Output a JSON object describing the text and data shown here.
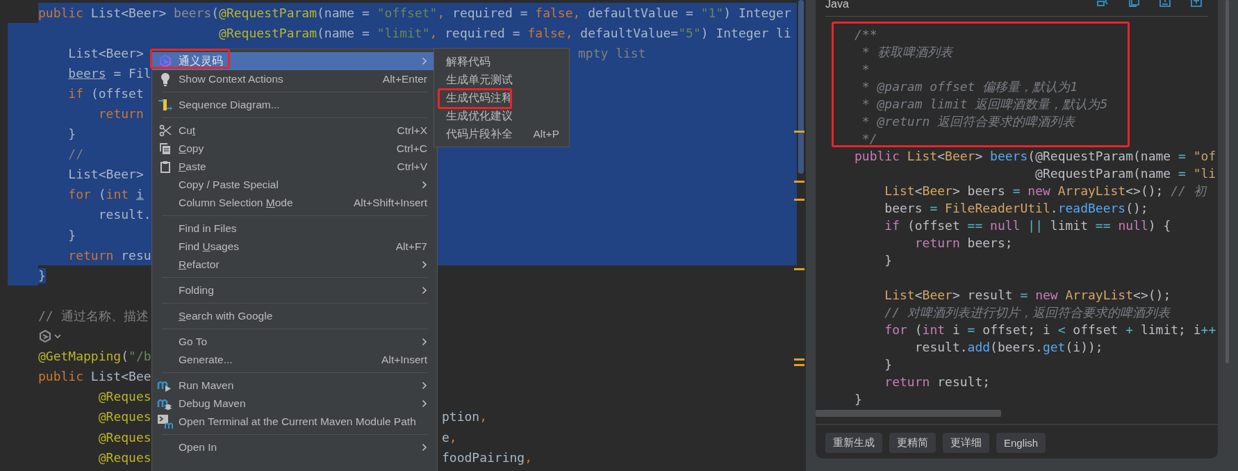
{
  "editor": {
    "lines": [
      {
        "kind": "code",
        "selected": true,
        "sel_start": true,
        "tokens": [
          {
            "text": "public ",
            "kind": "kw"
          },
          {
            "text": "List<Beer> ",
            "kind": "plain"
          },
          {
            "text": "beers",
            "kind": "muted"
          },
          {
            "text": "(",
            "kind": "plain"
          },
          {
            "text": "@RequestParam",
            "kind": "ann"
          },
          {
            "text": "(name = ",
            "kind": "plain"
          },
          {
            "text": "\"offset\"",
            "kind": "str"
          },
          {
            "text": ", ",
            "kind": "kw"
          },
          {
            "text": "required = ",
            "kind": "plain"
          },
          {
            "text": "false, ",
            "kind": "kw"
          },
          {
            "text": "defaultValue = ",
            "kind": "plain"
          },
          {
            "text": "\"1\"",
            "kind": "str"
          },
          {
            "text": ") Integer",
            "kind": "plain"
          }
        ]
      },
      {
        "kind": "code",
        "selected": true,
        "tokens": [
          {
            "text": "                        @RequestParam",
            "kind": "ann"
          },
          {
            "text": "(name = ",
            "kind": "plain"
          },
          {
            "text": "\"limit\"",
            "kind": "str"
          },
          {
            "text": ", ",
            "kind": "kw"
          },
          {
            "text": "required = ",
            "kind": "plain"
          },
          {
            "text": "false, ",
            "kind": "kw"
          },
          {
            "text": "defaultValue=",
            "kind": "plain"
          },
          {
            "text": "\"5\"",
            "kind": "str"
          },
          {
            "text": ") Integer li",
            "kind": "plain"
          }
        ]
      },
      {
        "kind": "code",
        "selected": true,
        "tokens": [
          {
            "text": "    List<Beer> ",
            "kind": "plain"
          }
        ],
        "tail": [
          {
            "text": "mpty list",
            "kind": "cmt"
          }
        ],
        "past_submenu": true
      },
      {
        "kind": "code",
        "selected": true,
        "tokens": [
          {
            "text": "    beers",
            "kind": "var"
          },
          {
            "text": " = Fil",
            "kind": "plain"
          }
        ]
      },
      {
        "kind": "code",
        "selected": true,
        "tokens": [
          {
            "text": "    if ",
            "kind": "kw"
          },
          {
            "text": "(offset ",
            "kind": "plain"
          }
        ]
      },
      {
        "kind": "code",
        "selected": true,
        "tokens": [
          {
            "text": "        return ",
            "kind": "kw"
          }
        ]
      },
      {
        "kind": "code",
        "selected": true,
        "tokens": [
          {
            "text": "    }",
            "kind": "plain"
          }
        ]
      },
      {
        "kind": "code",
        "selected": true,
        "tokens": [
          {
            "text": "    //",
            "kind": "cmt"
          }
        ]
      },
      {
        "kind": "code",
        "selected": true,
        "tokens": [
          {
            "text": "    List<Beer> ",
            "kind": "plain"
          }
        ]
      },
      {
        "kind": "code",
        "selected": true,
        "tokens": [
          {
            "text": "    for ",
            "kind": "kw"
          },
          {
            "text": "(",
            "kind": "plain"
          },
          {
            "text": "int ",
            "kind": "kw"
          },
          {
            "text": "i",
            "kind": "var"
          }
        ]
      },
      {
        "kind": "code",
        "selected": true,
        "tokens": [
          {
            "text": "        result.",
            "kind": "plain"
          }
        ]
      },
      {
        "kind": "code",
        "selected": true,
        "tokens": [
          {
            "text": "    }",
            "kind": "plain"
          }
        ]
      },
      {
        "kind": "code",
        "selected": true,
        "tokens": [
          {
            "text": "    return ",
            "kind": "kw"
          },
          {
            "text": "resu",
            "kind": "plain"
          }
        ]
      },
      {
        "kind": "code",
        "selected": true,
        "sel_end": true,
        "tokens": [
          {
            "text": "}",
            "kind": "plain"
          }
        ]
      },
      {
        "kind": "blank"
      },
      {
        "kind": "code",
        "tokens": [
          {
            "text": "// 通过名称、描述",
            "kind": "cmt"
          }
        ]
      },
      {
        "kind": "hint"
      },
      {
        "kind": "code",
        "tokens": [
          {
            "text": "@GetMapping",
            "kind": "ann"
          },
          {
            "text": "(",
            "kind": "plain"
          },
          {
            "text": "\"/b",
            "kind": "str"
          }
        ]
      },
      {
        "kind": "code",
        "tokens": [
          {
            "text": "public ",
            "kind": "kw"
          },
          {
            "text": "List<Bee",
            "kind": "plain"
          }
        ]
      },
      {
        "kind": "code",
        "tokens": [
          {
            "text": "        @Reques",
            "kind": "ann"
          }
        ]
      },
      {
        "kind": "code",
        "tokens": [
          {
            "text": "        @Reques",
            "kind": "ann"
          }
        ],
        "tail": [
          {
            "text": "ption",
            "kind": "plain"
          },
          {
            "text": ",",
            "kind": "kw"
          }
        ]
      },
      {
        "kind": "code",
        "tokens": [
          {
            "text": "        @Reques",
            "kind": "ann"
          }
        ],
        "tail": [
          {
            "text": "e",
            "kind": "plain"
          },
          {
            "text": ",",
            "kind": "kw"
          }
        ]
      },
      {
        "kind": "code",
        "tokens": [
          {
            "text": "        @Reques",
            "kind": "ann"
          }
        ],
        "tail": [
          {
            "text": "foodPairing",
            "kind": "plain"
          },
          {
            "text": ",",
            "kind": "kw"
          }
        ]
      }
    ]
  },
  "context_menu": {
    "groups": [
      [
        {
          "label": "通义灵码",
          "kind": "logo",
          "submenu": true,
          "selected": true,
          "framed": true
        },
        {
          "label": "Show Context Actions",
          "kind": "bulb",
          "shortcut": "Alt+Enter",
          "submenu": false,
          "selected": false
        }
      ],
      [
        {
          "label": "Sequence Diagram...",
          "kind": "diagram",
          "submenu": false,
          "selected": false
        }
      ],
      [
        {
          "before": "Cu",
          "mnemonic": "t",
          "kind": "scissors",
          "shortcut": "Ctrl+X",
          "submenu": false,
          "selected": false
        },
        {
          "mnemonic": "C",
          "after": "opy",
          "kind": "copy",
          "shortcut": "Ctrl+C",
          "submenu": false,
          "selected": false
        },
        {
          "mnemonic": "P",
          "after": "aste",
          "kind": "paste",
          "shortcut": "Ctrl+V",
          "submenu": false,
          "selected": false
        },
        {
          "label": "Copy / Paste Special",
          "submenu": true,
          "selected": false
        },
        {
          "before": "Column Selection ",
          "mnemonic": "M",
          "after": "ode",
          "shortcut": "Alt+Shift+Insert",
          "submenu": false,
          "selected": false
        }
      ],
      [
        {
          "label": "Find in Files",
          "submenu": false,
          "selected": false
        },
        {
          "before": "Find ",
          "mnemonic": "U",
          "after": "sages",
          "shortcut": "Alt+F7",
          "submenu": false,
          "selected": false
        },
        {
          "mnemonic": "R",
          "after": "efactor",
          "submenu": true,
          "selected": false
        }
      ],
      [
        {
          "label": "Folding",
          "submenu": true,
          "selected": false
        }
      ],
      [
        {
          "mnemonic": "S",
          "after": "earch with Google",
          "submenu": false,
          "selected": false
        }
      ],
      [
        {
          "label": "Go To",
          "submenu": true,
          "selected": false
        },
        {
          "label": "Generate...",
          "shortcut": "Alt+Insert",
          "submenu": false,
          "selected": false
        }
      ],
      [
        {
          "label": "Run Maven",
          "kind": "maven_run",
          "submenu": true,
          "selected": false
        },
        {
          "label": "Debug Maven",
          "kind": "maven_debug",
          "submenu": true,
          "selected": false
        },
        {
          "label": "Open Terminal at the Current Maven Module Path",
          "kind": "terminal",
          "submenu": false,
          "selected": false
        }
      ],
      [
        {
          "label": "Open In",
          "submenu": true,
          "selected": false
        }
      ]
    ]
  },
  "submenu": {
    "items": [
      {
        "label": "解释代码",
        "selected": false
      },
      {
        "label": "生成单元测试",
        "selected": false
      },
      {
        "label": "生成代码注释",
        "selected": false,
        "framed": true
      },
      {
        "label": "生成优化建议",
        "selected": false
      },
      {
        "label": "代码片段补全",
        "shortcut": "Alt+P",
        "selected": false
      }
    ]
  },
  "panel": {
    "title": "Java",
    "doc_comment": {
      "framed": true,
      "lines": [
        [
          {
            "text": "/**",
            "kind": "cmt"
          }
        ],
        [
          {
            "text": " * 获取啤酒列表",
            "kind": "cmt"
          }
        ],
        [
          {
            "text": " *",
            "kind": "cmt"
          }
        ],
        [
          {
            "text": " * @param offset 偏移量，默认为1",
            "kind": "cmt"
          }
        ],
        [
          {
            "text": " * @param limit 返回啤酒数量，默认为5",
            "kind": "cmt"
          }
        ],
        [
          {
            "text": " * @return 返回符合要求的啤酒列表",
            "kind": "cmt"
          }
        ],
        [
          {
            "text": " */",
            "kind": "cmt"
          }
        ]
      ]
    },
    "lines": [
      {
        "kind": "code",
        "tokens": [
          {
            "text": "public ",
            "kind": "kw"
          },
          {
            "text": "List",
            "kind": "type"
          },
          {
            "text": "<",
            "kind": "plain"
          },
          {
            "text": "Beer",
            "kind": "type"
          },
          {
            "text": "> ",
            "kind": "plain"
          },
          {
            "text": "beers",
            "kind": "fn"
          },
          {
            "text": "(@RequestParam(name ",
            "kind": "plain"
          },
          {
            "text": "=",
            "kind": "op"
          },
          {
            "text": " \"of",
            "kind": "str"
          }
        ]
      },
      {
        "kind": "code",
        "tokens": [
          {
            "text": "                        @RequestParam(name ",
            "kind": "plain"
          },
          {
            "text": "=",
            "kind": "op"
          },
          {
            "text": " \"li",
            "kind": "str"
          }
        ]
      },
      {
        "kind": "code",
        "tokens": [
          {
            "text": "    List",
            "kind": "type"
          },
          {
            "text": "<",
            "kind": "plain"
          },
          {
            "text": "Beer",
            "kind": "type"
          },
          {
            "text": "> beers ",
            "kind": "plain"
          },
          {
            "text": "=",
            "kind": "op"
          },
          {
            "text": " new ",
            "kind": "kw"
          },
          {
            "text": "ArrayList",
            "kind": "type"
          },
          {
            "text": "<>(); ",
            "kind": "plain"
          },
          {
            "text": "// 初",
            "kind": "cmt"
          }
        ]
      },
      {
        "kind": "code",
        "tokens": [
          {
            "text": "    beers ",
            "kind": "plain"
          },
          {
            "text": "=",
            "kind": "op"
          },
          {
            "text": " FileReaderUtil",
            "kind": "type"
          },
          {
            "text": ".",
            "kind": "plain"
          },
          {
            "text": "readBeers",
            "kind": "fn"
          },
          {
            "text": "();",
            "kind": "plain"
          }
        ]
      },
      {
        "kind": "code",
        "tokens": [
          {
            "text": "    if ",
            "kind": "kw"
          },
          {
            "text": "(offset ",
            "kind": "plain"
          },
          {
            "text": "==",
            "kind": "op"
          },
          {
            "text": " null ",
            "kind": "kw"
          },
          {
            "text": "||",
            "kind": "op"
          },
          {
            "text": " limit ",
            "kind": "plain"
          },
          {
            "text": "==",
            "kind": "op"
          },
          {
            "text": " null",
            "kind": "kw"
          },
          {
            "text": ") {",
            "kind": "plain"
          }
        ]
      },
      {
        "kind": "code",
        "tokens": [
          {
            "text": "        return ",
            "kind": "kw"
          },
          {
            "text": "beers;",
            "kind": "plain"
          }
        ]
      },
      {
        "kind": "code",
        "tokens": [
          {
            "text": "    }",
            "kind": "plain"
          }
        ]
      },
      {
        "kind": "blank"
      },
      {
        "kind": "code",
        "tokens": [
          {
            "text": "    List",
            "kind": "type"
          },
          {
            "text": "<",
            "kind": "plain"
          },
          {
            "text": "Beer",
            "kind": "type"
          },
          {
            "text": "> result ",
            "kind": "plain"
          },
          {
            "text": "=",
            "kind": "op"
          },
          {
            "text": " new ",
            "kind": "kw"
          },
          {
            "text": "ArrayList",
            "kind": "type"
          },
          {
            "text": "<>();",
            "kind": "plain"
          }
        ]
      },
      {
        "kind": "code",
        "tokens": [
          {
            "text": "    // 对啤酒列表进行切片，返回符合要求的啤酒列表",
            "kind": "cmt"
          }
        ]
      },
      {
        "kind": "code",
        "tokens": [
          {
            "text": "    for ",
            "kind": "kw"
          },
          {
            "text": "(",
            "kind": "plain"
          },
          {
            "text": "int ",
            "kind": "kw"
          },
          {
            "text": "i ",
            "kind": "plain"
          },
          {
            "text": "=",
            "kind": "op"
          },
          {
            "text": " offset; i ",
            "kind": "plain"
          },
          {
            "text": "<",
            "kind": "op"
          },
          {
            "text": " offset ",
            "kind": "plain"
          },
          {
            "text": "+",
            "kind": "op"
          },
          {
            "text": " limit; i",
            "kind": "plain"
          },
          {
            "text": "++",
            "kind": "op"
          }
        ]
      },
      {
        "kind": "code",
        "tokens": [
          {
            "text": "        result.",
            "kind": "plain"
          },
          {
            "text": "add",
            "kind": "fn"
          },
          {
            "text": "(beers.",
            "kind": "plain"
          },
          {
            "text": "get",
            "kind": "fn"
          },
          {
            "text": "(i));",
            "kind": "plain"
          }
        ]
      },
      {
        "kind": "code",
        "tokens": [
          {
            "text": "    }",
            "kind": "plain"
          }
        ]
      },
      {
        "kind": "code",
        "tokens": [
          {
            "text": "    return ",
            "kind": "kw"
          },
          {
            "text": "result;",
            "kind": "plain"
          }
        ]
      },
      {
        "kind": "code",
        "tokens": [
          {
            "text": "}",
            "kind": "plain"
          }
        ]
      }
    ],
    "buttons": [
      "重新生成",
      "更精简",
      "更详细",
      "English"
    ]
  }
}
